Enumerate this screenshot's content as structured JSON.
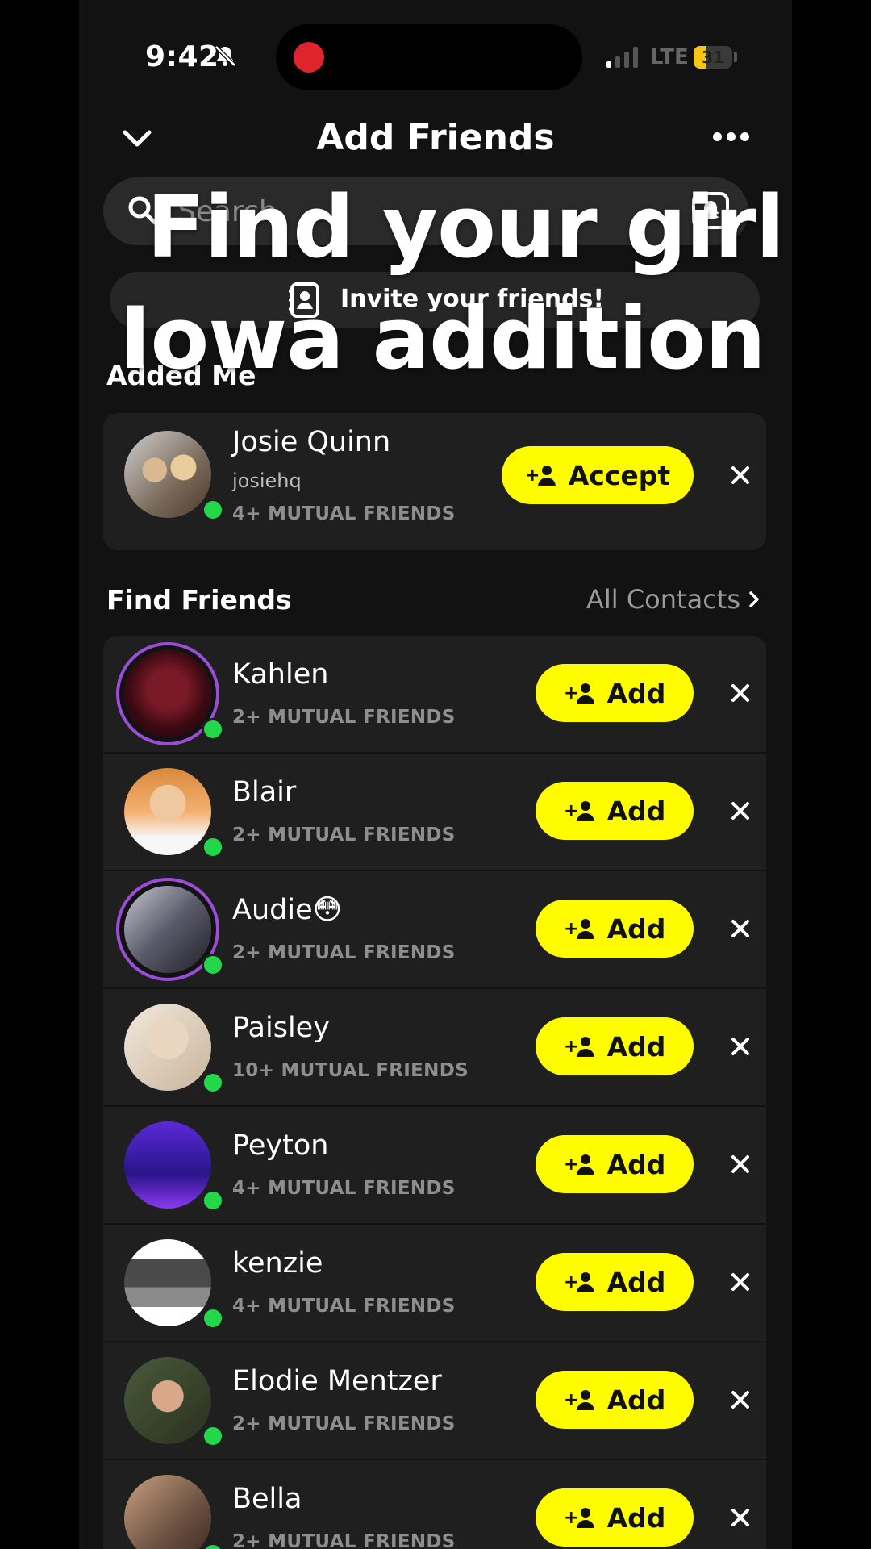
{
  "status_bar": {
    "time": "9:42",
    "network": "LTE",
    "battery": "31",
    "battery_level": 0.31
  },
  "header": {
    "title": "Add Friends"
  },
  "search": {
    "placeholder": "Search"
  },
  "invite": {
    "label": "Invite your friends!"
  },
  "overlay_caption": {
    "line1": "Find your girl",
    "line2": "Iowa addition"
  },
  "added_me": {
    "section_title": "Added Me",
    "items": [
      {
        "name": "Josie Quinn",
        "username": "josiehq",
        "mutual": "4+ MUTUAL FRIENDS",
        "action": "Accept"
      }
    ]
  },
  "find_friends": {
    "section_title": "Find Friends",
    "all_contacts": "All Contacts",
    "items": [
      {
        "name": "Kahlen",
        "mutual": "2+ MUTUAL FRIENDS",
        "action": "Add",
        "ring": true
      },
      {
        "name": "Blair",
        "mutual": "2+ MUTUAL FRIENDS",
        "action": "Add",
        "ring": false
      },
      {
        "name": "Audie😳",
        "mutual": "2+ MUTUAL FRIENDS",
        "action": "Add",
        "ring": true
      },
      {
        "name": "Paisley",
        "mutual": "10+ MUTUAL FRIENDS",
        "action": "Add",
        "ring": false
      },
      {
        "name": "Peyton",
        "mutual": "4+ MUTUAL FRIENDS",
        "action": "Add",
        "ring": false
      },
      {
        "name": "kenzie",
        "mutual": "4+ MUTUAL FRIENDS",
        "action": "Add",
        "ring": false
      },
      {
        "name": "Elodie Mentzer",
        "mutual": "2+ MUTUAL FRIENDS",
        "action": "Add",
        "ring": false
      },
      {
        "name": "Bella",
        "mutual": "2+ MUTUAL FRIENDS",
        "action": "Add",
        "ring": false
      }
    ]
  },
  "colors": {
    "accent": "#fffc00",
    "online": "#22d84a",
    "story_ring": "#9b4dd8",
    "background": "#121212",
    "card": "#1f1f1f"
  }
}
